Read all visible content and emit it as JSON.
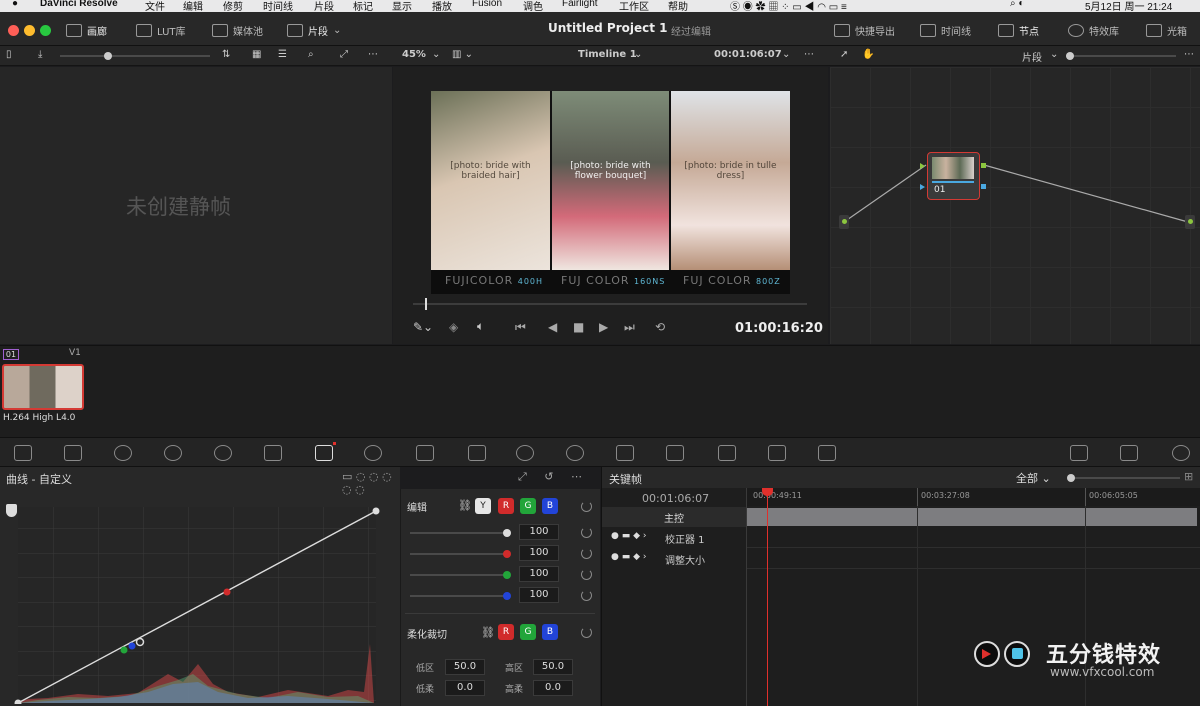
{
  "menubar": {
    "app": "DaVinci Resolve",
    "items": [
      "文件",
      "编辑",
      "修剪",
      "时间线",
      "片段",
      "标记",
      "显示",
      "播放",
      "Fusion",
      "调色",
      "Fairlight",
      "工作区",
      "帮助"
    ],
    "datetime": "5月12日 周一  21:24"
  },
  "titlebar": {
    "project": "Untitled Project 1",
    "mode": "经过编辑",
    "left_tabs": [
      "画廊",
      "LUT库",
      "媒体池",
      "片段"
    ],
    "right_tabs": [
      "快捷导出",
      "时间线",
      "节点",
      "特效库",
      "光箱"
    ]
  },
  "toolbar2": {
    "zoom": "45%",
    "timeline": "Timeline 1",
    "timecode": "00:01:06:07",
    "node_mode": "片段"
  },
  "gallery": {
    "empty_text": "未创建静帧"
  },
  "viewer": {
    "playhead_timecode": "01:00:16:20",
    "photos": [
      {
        "caption_main": "FUJICOLOR",
        "caption_num": "400H",
        "label": "[photo: bride with braided hair]"
      },
      {
        "caption_main": "FUJ COLOR",
        "caption_num": "160NS",
        "label": "[photo: bride with flower bouquet]"
      },
      {
        "caption_main": "FUJ COLOR",
        "caption_num": "800Z",
        "label": "[photo: bride in tulle dress]"
      }
    ],
    "scrub_progress": 0.03
  },
  "nodes": {
    "node_label": "01"
  },
  "clips": {
    "clip_number": "01",
    "track": "V1",
    "codec": "H.264 High L4.0"
  },
  "curves": {
    "title": "曲线 - 自定义",
    "edit_label": "编辑",
    "soft_clip_label": "柔化裁切",
    "channels": [
      "Y",
      "R",
      "G",
      "B"
    ],
    "values": [
      "100",
      "100",
      "100",
      "100"
    ],
    "soft": {
      "low_label": "低区",
      "low_value": "50.0",
      "high_label": "高区",
      "high_value": "50.0",
      "lowsoft_label": "低柔",
      "lowsoft_value": "0.0",
      "highsoft_label": "高柔",
      "highsoft_value": "0.0"
    }
  },
  "keyframes": {
    "title": "关键帧",
    "filter": "全部",
    "current_tc": "00:01:06:07",
    "ruler": [
      "00:00:49:11",
      "00:03:27:08",
      "00:06:05:05"
    ],
    "tracks": [
      "主控",
      "校正器 1",
      "调整大小"
    ]
  },
  "watermark": {
    "cn": "五分钱特效",
    "url": "www.vfxcool.com"
  },
  "colors": {
    "accent_red": "#e0302c",
    "node_border": "#d43a34",
    "keyframe_bar": "#7d7d80"
  }
}
